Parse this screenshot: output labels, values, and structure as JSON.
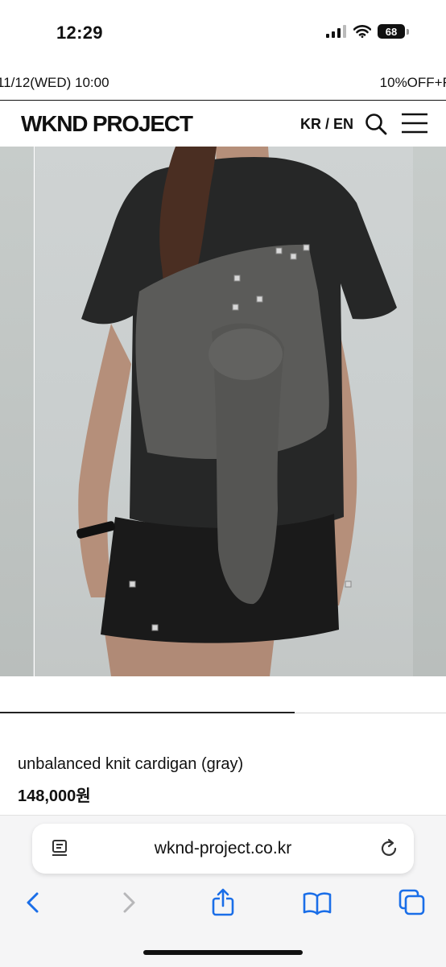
{
  "status_bar": {
    "time": "12:29",
    "battery": "68"
  },
  "promo": {
    "left_text": "11/12(WED) 10:00",
    "right_text": "10%OFF+F"
  },
  "header": {
    "logo": "WKND PROJECT",
    "language": "KR / EN",
    "icons": [
      "search-icon",
      "hamburger-menu-icon"
    ]
  },
  "product": {
    "name": "unbalanced knit cardigan (gray)",
    "price": "148,000원",
    "image_progress": 0.66
  },
  "browser": {
    "url": "wknd-project.co.kr",
    "toolbar": [
      "back-icon",
      "forward-icon",
      "share-icon",
      "bookmarks-icon",
      "tabs-icon"
    ]
  },
  "colors": {
    "accent": "#1a6ee8",
    "text": "#111111",
    "knit_gray": "#595957",
    "tee_black": "#262727"
  }
}
